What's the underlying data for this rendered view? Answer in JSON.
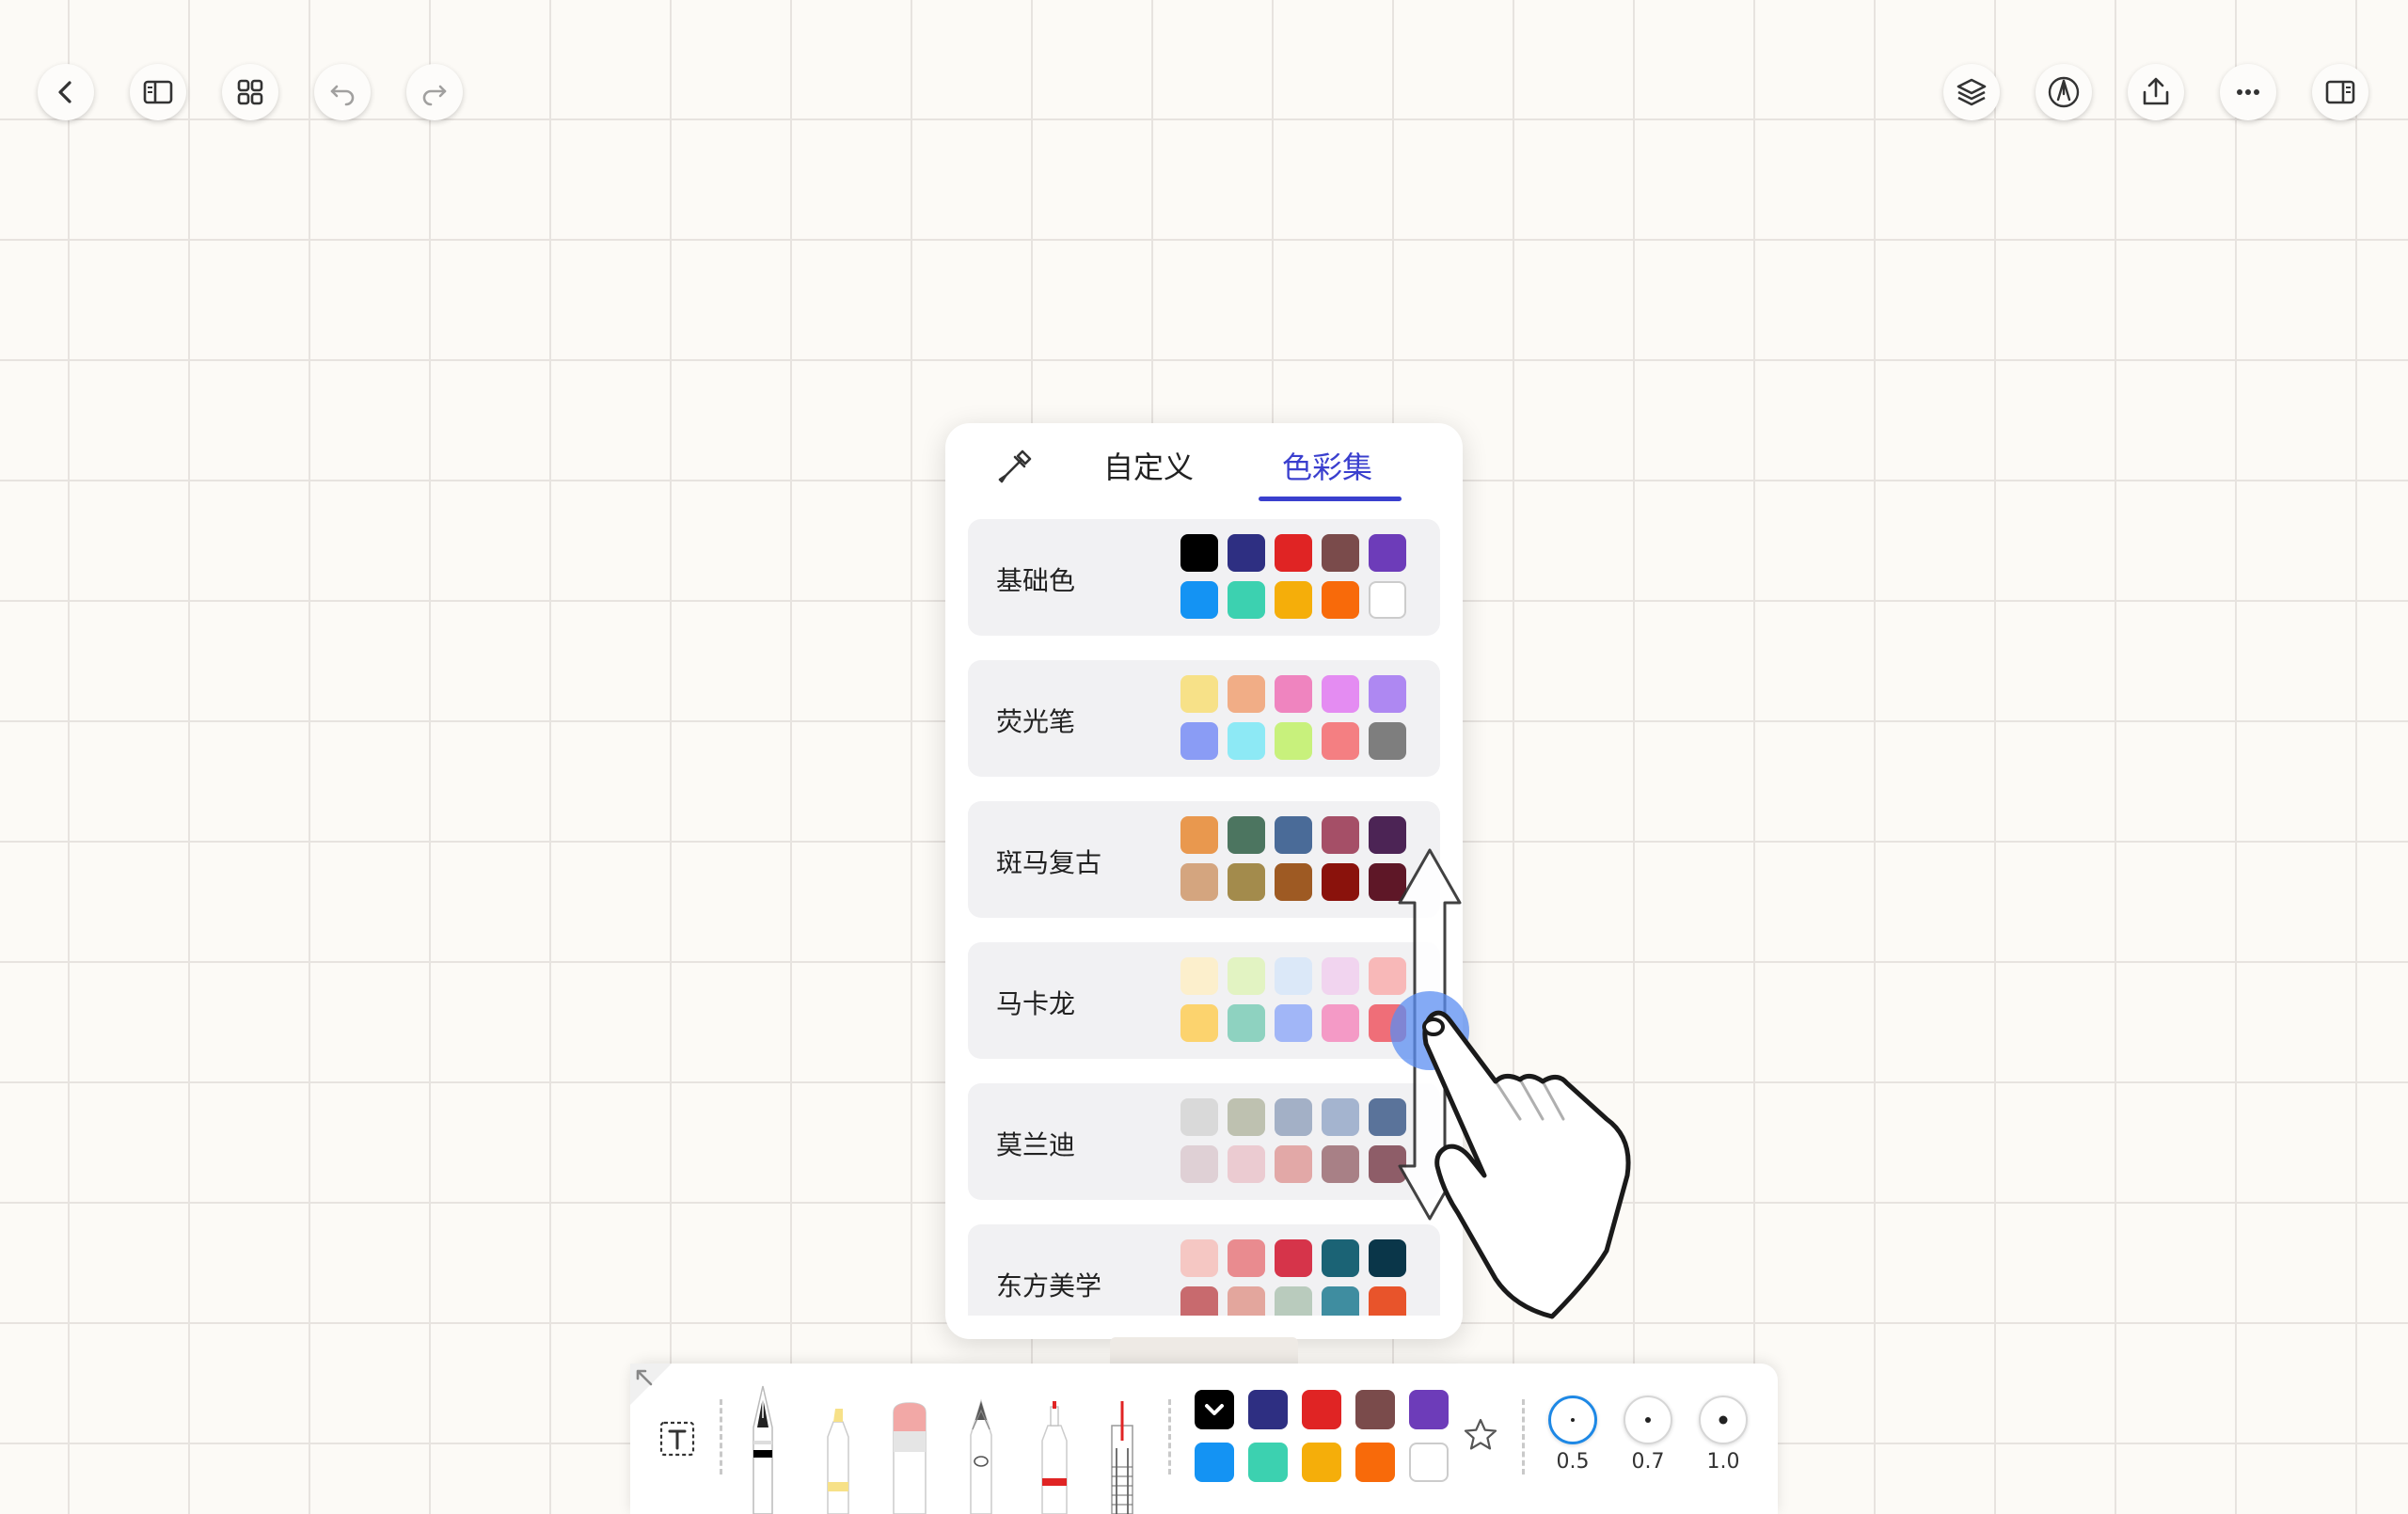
{
  "top_left_buttons": [
    {
      "name": "back-button",
      "icon": "chevron-left-icon"
    },
    {
      "name": "sidebar-toggle-button",
      "icon": "sidebar-left-icon"
    },
    {
      "name": "grid-view-button",
      "icon": "grid-icon"
    },
    {
      "name": "undo-button",
      "icon": "undo-icon"
    },
    {
      "name": "redo-button",
      "icon": "redo-icon"
    }
  ],
  "top_right_buttons": [
    {
      "name": "layers-button",
      "icon": "layers-icon"
    },
    {
      "name": "pen-mode-button",
      "icon": "pen-nib-icon"
    },
    {
      "name": "share-button",
      "icon": "share-upload-icon"
    },
    {
      "name": "more-button",
      "icon": "more-dots-icon"
    },
    {
      "name": "right-panel-button",
      "icon": "sidebar-right-icon"
    }
  ],
  "color_popup": {
    "tabs": [
      "自定义",
      "色彩集"
    ],
    "active_tab": "色彩集",
    "accent": "#3a3fce",
    "groups": [
      {
        "name": "基础色",
        "colors": [
          "#000000",
          "#2e2f82",
          "#e02424",
          "#7a4b4b",
          "#6d3cb9",
          "#1493f3",
          "#3cd1b0",
          "#f5ae0a",
          "#f86a0a",
          "#ffffff"
        ]
      },
      {
        "name": "荧光笔",
        "colors": [
          "#f7e188",
          "#f1ad86",
          "#ef84bf",
          "#e48cf2",
          "#ae88f2",
          "#8a9cf5",
          "#8de9f5",
          "#c8f17c",
          "#f47f82",
          "#7e7e7e"
        ]
      },
      {
        "name": "斑马复古",
        "colors": [
          "#e9984e",
          "#4c7560",
          "#4a6b98",
          "#a54f67",
          "#4c2455",
          "#d4a57f",
          "#a38b4c",
          "#9e5a23",
          "#8a120c",
          "#5e1727"
        ]
      },
      {
        "name": "马卡龙",
        "colors": [
          "#fcefcc",
          "#e2f3c2",
          "#dbe8f8",
          "#f1d4ef",
          "#f8b8b8",
          "#fcd36e",
          "#8ed2c0",
          "#a1b6f7",
          "#f49ac6",
          "#ef6e78"
        ]
      },
      {
        "name": "莫兰迪",
        "colors": [
          "#d9d9d9",
          "#bec1b0",
          "#a3b0c6",
          "#a4b4cf",
          "#5a739a",
          "#dfd0d5",
          "#ebcbd1",
          "#e2a8a7",
          "#a88086",
          "#8e5d68"
        ]
      },
      {
        "name": "东方美学",
        "colors": [
          "#f5c7c3",
          "#e98b8f",
          "#d6344a",
          "#1b6375",
          "#0a3649",
          "#c86a6e",
          "#e3a69d",
          "#b9cbbd",
          "#3f8da0",
          "#e8542b"
        ]
      }
    ]
  },
  "toolbar": {
    "tools": [
      "lasso-tool",
      "text-tool",
      "fountain-pen",
      "highlighter",
      "eraser",
      "pencil",
      "marker",
      "ruler-pen"
    ],
    "colors": [
      "#000000",
      "#2e2f82",
      "#e02424",
      "#7a4b4b",
      "#6d3cb9",
      "#1493f3",
      "#3cd1b0",
      "#f5ae0a",
      "#f86a0a",
      "#ffffff"
    ],
    "selected_color": "#000000",
    "sizes": [
      {
        "label": "0.5",
        "active": true
      },
      {
        "label": "0.7",
        "active": false
      },
      {
        "label": "1.0",
        "active": false
      }
    ]
  }
}
